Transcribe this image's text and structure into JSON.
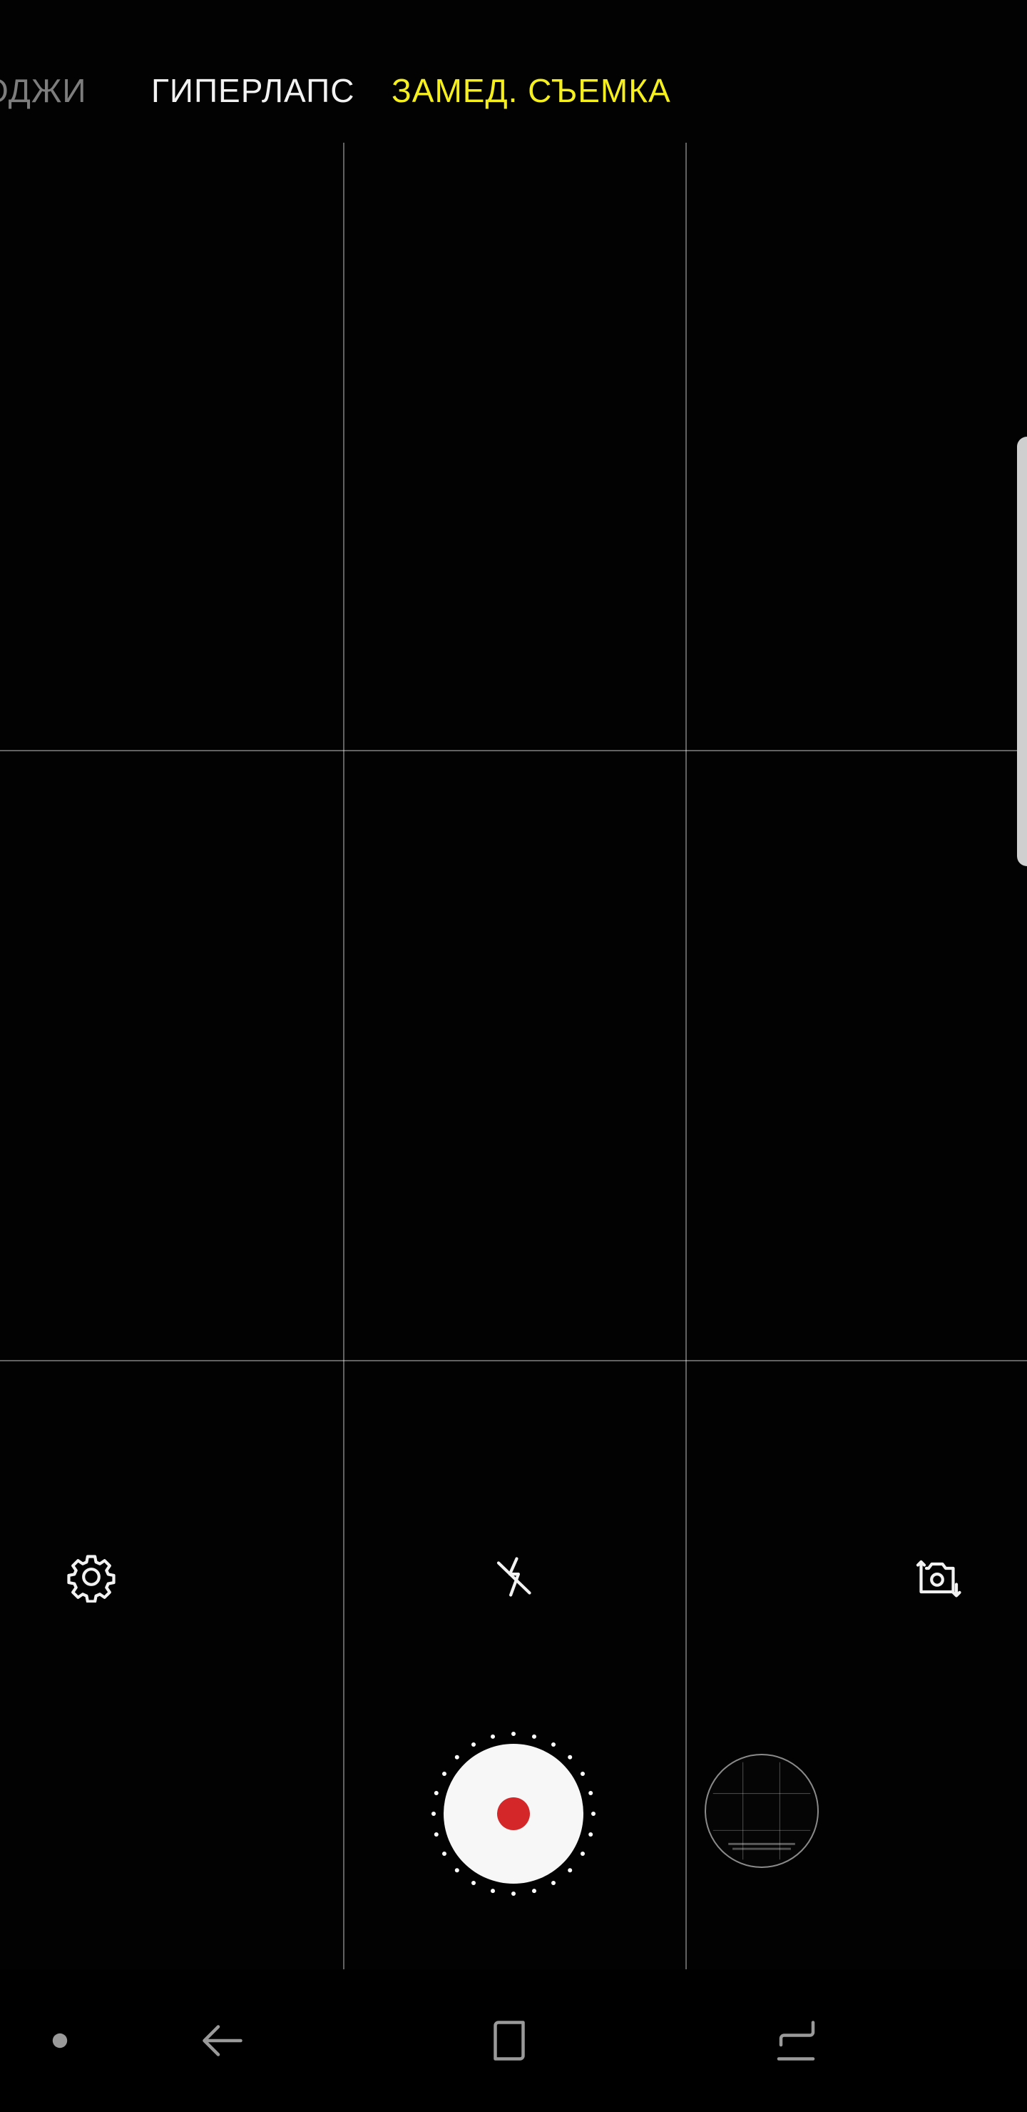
{
  "modes": {
    "emoji": "ОДЖИ",
    "hyperlapse": "ГИПЕРЛАПС",
    "slow_motion": "ЗАМЕД. СЪЕМКА"
  },
  "colors": {
    "active_mode": "#f5ef1e",
    "inactive_mode": "#f2f2f2",
    "faded_mode": "#7d7d7d",
    "record": "#d42729",
    "shutter": "#f7f7f7"
  },
  "controls": {
    "settings_icon": "gear-icon",
    "flash_icon": "flash-off-icon",
    "switch_camera_icon": "switch-camera-icon"
  },
  "shutter": {
    "icon": "record-icon"
  },
  "navigation": {
    "items": [
      "dot-indicator",
      "back-icon",
      "home-icon",
      "recents-icon"
    ]
  }
}
